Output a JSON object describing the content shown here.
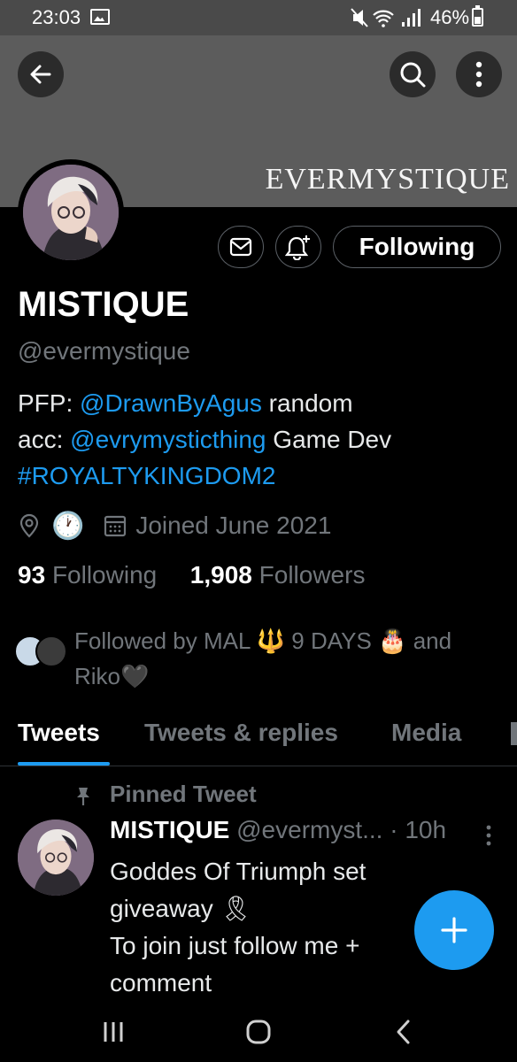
{
  "status_bar": {
    "time": "23:03",
    "battery": "46%"
  },
  "banner": {
    "text": "EVERMYSTIQUE"
  },
  "profile": {
    "display_name": "MISTIQUE",
    "handle": "@evermystique",
    "following_button": "Following",
    "bio": {
      "pfp_label": "PFP:",
      "pfp_link": "@DrawnByAgus",
      "random_label": "random",
      "acc_label": "acc:",
      "acc_link": "@evrymysticthing",
      "role": "Game Dev",
      "hashtag": "#ROYALTYKINGDOM2"
    },
    "clock_emoji": "🕐",
    "joined": "Joined June 2021",
    "following_count": "93",
    "following_label": "Following",
    "followers_count": "1,908",
    "followers_label": "Followers",
    "followed_by": {
      "prefix": "Followed by MAL",
      "emoji_1": "🔱",
      "middle": "9 DAYS",
      "emoji_2": "🎂",
      "and": "and",
      "last": "Riko",
      "heart": "🖤"
    }
  },
  "tabs": [
    "Tweets",
    "Tweets & replies",
    "Media"
  ],
  "pinned_tweet": {
    "label": "Pinned Tweet",
    "name": "MISTIQUE",
    "handle": "@evermyst...",
    "separator": "·",
    "time": "10h",
    "text": "Goddes Of Triumph set\ngiveaway 🎗\nTo join just follow me +\ncomment"
  },
  "colors": {
    "accent": "#1d9bf0",
    "background": "#000000",
    "banner": "#5c5c5c",
    "muted": "#71767b"
  },
  "icons": [
    "back-arrow-icon",
    "search-icon",
    "more-vertical-icon",
    "mail-icon",
    "bell-plus-icon",
    "location-icon",
    "calendar-icon",
    "pin-icon",
    "plus-icon"
  ]
}
